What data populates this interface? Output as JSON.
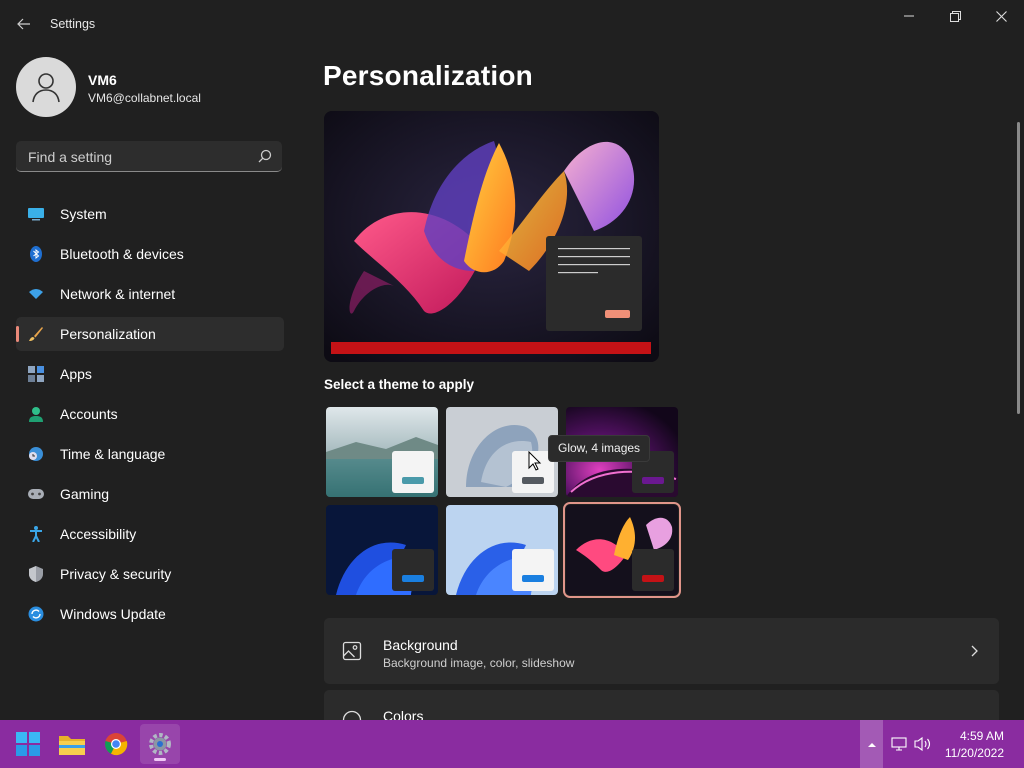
{
  "window": {
    "title": "Settings"
  },
  "user": {
    "name": "VM6",
    "email": "VM6@collabnet.local"
  },
  "search": {
    "placeholder": "Find a setting"
  },
  "nav": [
    {
      "label": "System",
      "icon": "monitor-icon"
    },
    {
      "label": "Bluetooth & devices",
      "icon": "bluetooth-icon"
    },
    {
      "label": "Network & internet",
      "icon": "wifi-icon"
    },
    {
      "label": "Personalization",
      "icon": "brush-icon",
      "active": true
    },
    {
      "label": "Apps",
      "icon": "apps-icon"
    },
    {
      "label": "Accounts",
      "icon": "person-icon"
    },
    {
      "label": "Time & language",
      "icon": "globe-clock-icon"
    },
    {
      "label": "Gaming",
      "icon": "gamepad-icon"
    },
    {
      "label": "Accessibility",
      "icon": "accessibility-icon"
    },
    {
      "label": "Privacy & security",
      "icon": "shield-icon"
    },
    {
      "label": "Windows Update",
      "icon": "update-icon"
    }
  ],
  "page": {
    "title": "Personalization"
  },
  "themes": {
    "section_label": "Select a theme to apply",
    "tooltip": "Glow, 4 images",
    "items": [
      {
        "name": "lake"
      },
      {
        "name": "captured-motion"
      },
      {
        "name": "glow"
      },
      {
        "name": "windows-dark"
      },
      {
        "name": "windows-light"
      },
      {
        "name": "flow",
        "selected": true
      }
    ]
  },
  "cards": [
    {
      "title": "Background",
      "desc": "Background image, color, slideshow",
      "icon": "image-icon"
    },
    {
      "title": "Colors",
      "desc": "",
      "icon": "palette-icon"
    }
  ],
  "taskbar": {
    "apps": [
      "windows-start-icon",
      "file-explorer-icon",
      "chrome-icon",
      "settings-icon"
    ],
    "time": "4:59 AM",
    "date": "11/20/2022"
  },
  "colors": {
    "accent": "#e0958a",
    "taskbar": "#8a2ca0",
    "background": "#202020"
  }
}
